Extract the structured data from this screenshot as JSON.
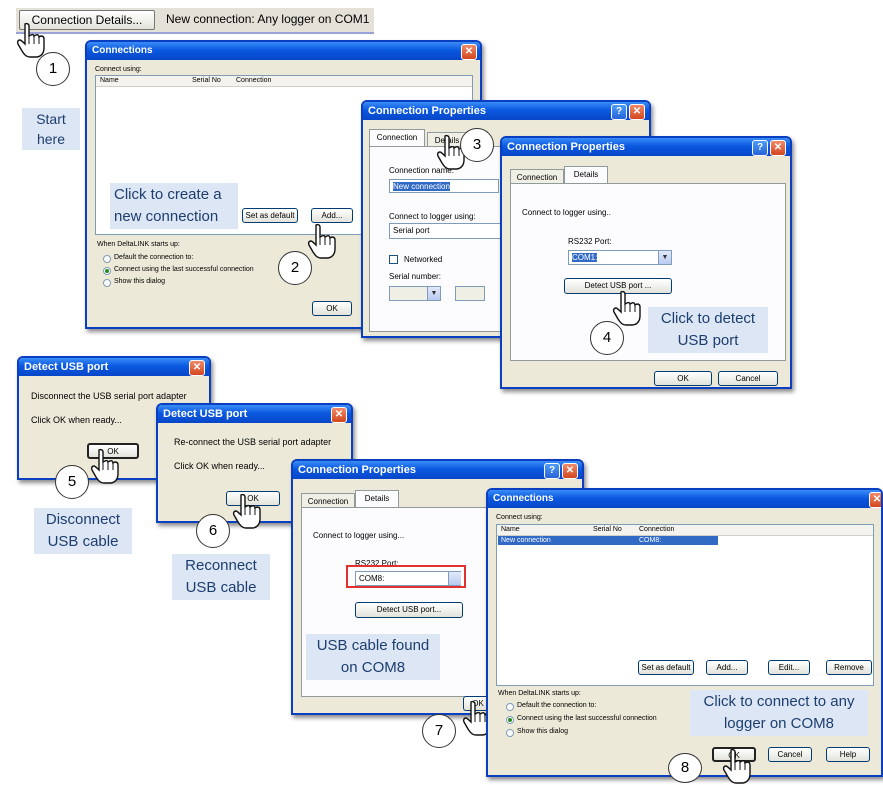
{
  "topbar": {
    "button_label": "Connection Details...",
    "status": "New connection: Any logger on COM1"
  },
  "steps": [
    "1",
    "2",
    "3",
    "4",
    "5",
    "6",
    "7",
    "8"
  ],
  "notes": {
    "start": "Start here",
    "click_create": "Click to create a new connection",
    "click_detect": "Click to detect USB port",
    "disconnect": "Disconnect USB cable",
    "reconnect": "Reconnect USB cable",
    "cable_found": "USB cable found on COM8",
    "click_connect": "Click to connect to any logger on COM8"
  },
  "conn1": {
    "title": "Connections",
    "connect_using": "Connect using:",
    "col_name": "Name",
    "col_serial": "Serial No",
    "col_conn": "Connection",
    "set_default": "Set as default",
    "add": "Add...",
    "startup_label": "When DeltaLINK starts up:",
    "options": [
      "Default the connection to:",
      "Connect using the last successful connection",
      "Show this dialog"
    ],
    "ok": "OK"
  },
  "props1": {
    "title": "Connection Properties",
    "tab_connection": "Connection",
    "tab_details": "Details",
    "connection_name_label": "Connection name:",
    "connection_name_value": "New connection",
    "connect_label": "Connect to logger using:",
    "connect_value": "Serial port",
    "networked": "Networked",
    "serial_number": "Serial number:"
  },
  "props2": {
    "title": "Connection Properties",
    "tab_connection": "Connection",
    "tab_details": "Details",
    "connect_label": "Connect to logger using..",
    "port_label": "RS232 Port:",
    "port_value": "COM1:",
    "detect": "Detect USB port ...",
    "ok": "OK",
    "cancel": "Cancel"
  },
  "detect1": {
    "title": "Detect USB port",
    "line1": "Disconnect the USB serial port adapter",
    "line2": "Click OK when ready...",
    "ok": "OK"
  },
  "detect2": {
    "title": "Detect USB port",
    "line1": "Re-connect the USB serial port adapter",
    "line2": "Click OK when ready...",
    "ok": "OK"
  },
  "props3": {
    "title": "Connection Properties",
    "tab_connection": "Connection",
    "tab_details": "Details",
    "connect_label": "Connect to logger using...",
    "port_label": "RS232 Port:",
    "port_value": "COM8:",
    "detect": "Detect USB port...",
    "ok": "OK"
  },
  "conn2": {
    "title": "Connections",
    "connect_using": "Connect using:",
    "col_name": "Name",
    "col_serial": "Serial No",
    "col_conn": "Connection",
    "row_name": "New connection",
    "row_conn": "COM8:",
    "set_default": "Set as default",
    "add": "Add...",
    "edit": "Edit...",
    "remove": "Remove",
    "startup_label": "When DeltaLINK starts up:",
    "options": [
      "Default the connection to:",
      "Connect using the last successful connection",
      "Show this dialog"
    ],
    "ok": "OK",
    "cancel": "Cancel",
    "help": "Help"
  },
  "colors": {
    "titlebar": "#0a59e0",
    "dialog": "#ece9d8",
    "note_bg": "#dce6f4",
    "note_text": "#1d3e6e",
    "highlight": "#e03030"
  }
}
